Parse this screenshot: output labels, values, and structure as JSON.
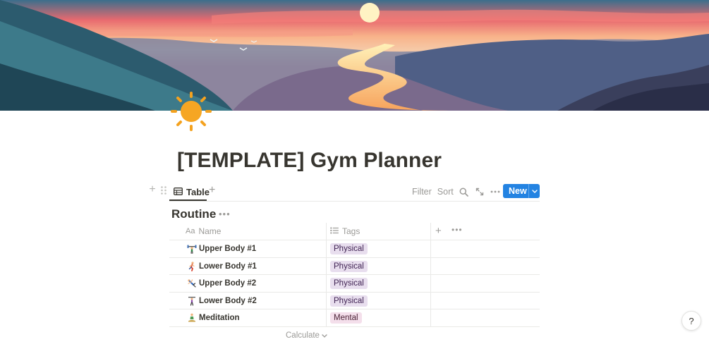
{
  "page": {
    "title": "[TEMPLATE] Gym Planner",
    "icon": "sun-emoji-icon",
    "cover": "sunset-valley-illustration"
  },
  "view_bar": {
    "tab_label": "Table",
    "filter_label": "Filter",
    "sort_label": "Sort",
    "new_label": "New"
  },
  "database": {
    "title": "Routine",
    "columns": [
      {
        "label": "Name",
        "icon": "text-property-icon",
        "icon_text": "Aa"
      },
      {
        "label": "Tags",
        "icon": "list-property-icon"
      }
    ],
    "rows": [
      {
        "name": "Upper Body #1",
        "emoji": "weightlifter-emoji-icon",
        "tag": "Physical"
      },
      {
        "name": "Lower Body #1",
        "emoji": "runner-emoji-icon",
        "tag": "Physical"
      },
      {
        "name": "Upper Body #2",
        "emoji": "cartwheel-emoji-icon",
        "tag": "Physical"
      },
      {
        "name": "Lower Body #2",
        "emoji": "walker-emoji-icon",
        "tag": "Physical"
      },
      {
        "name": "Meditation",
        "emoji": "meditation-emoji-icon",
        "tag": "Mental"
      }
    ],
    "calculate_label": "Calculate"
  },
  "help": {
    "label": "?"
  },
  "colors": {
    "accent": "#2383e2",
    "text": "#37352f",
    "muted": "#9b9a97",
    "tag_physical_bg": "#e8deee",
    "tag_mental_bg": "#f4dfeb"
  }
}
